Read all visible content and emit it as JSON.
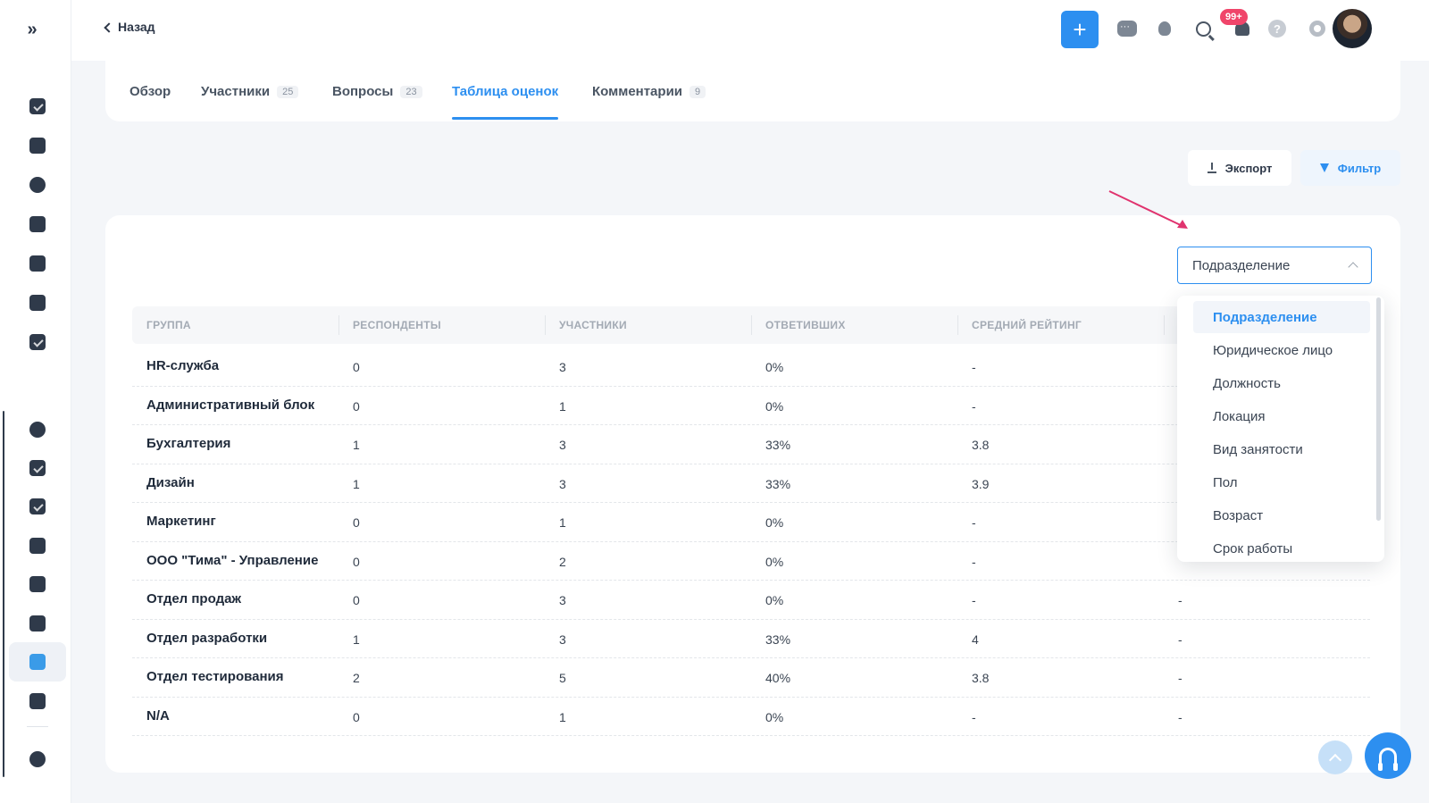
{
  "header": {
    "back_label": "Назад",
    "add_label": "+",
    "help_label": "?",
    "notifications_badge": "99+"
  },
  "tabs": [
    {
      "label": "Обзор",
      "count": ""
    },
    {
      "label": "Участники",
      "count": "25"
    },
    {
      "label": "Вопросы",
      "count": "23"
    },
    {
      "label": "Таблица оценок",
      "count": "",
      "active": true
    },
    {
      "label": "Комментарии",
      "count": "9"
    }
  ],
  "actions": {
    "export_label": "Экспорт",
    "filter_label": "Фильтр"
  },
  "grouping_select": {
    "value": "Подразделение",
    "options": [
      "Подразделение",
      "Юридическое лицо",
      "Должность",
      "Локация",
      "Вид занятости",
      "Пол",
      "Возраст",
      "Срок работы"
    ]
  },
  "table": {
    "columns": [
      "ГРУППА",
      "РЕСПОНДЕНТЫ",
      "УЧАСТНИКИ",
      "ОТВЕТИВШИХ",
      "СРЕДНИЙ РЕЙТИНГ"
    ],
    "rows": [
      {
        "group": "HR-служба",
        "respondents": "0",
        "participants": "3",
        "answered": "0%",
        "rating": "-",
        "extra": ""
      },
      {
        "group": "Административный блок",
        "respondents": "0",
        "participants": "1",
        "answered": "0%",
        "rating": "-",
        "extra": ""
      },
      {
        "group": "Бухгалтерия",
        "respondents": "1",
        "participants": "3",
        "answered": "33%",
        "rating": "3.8",
        "extra": ""
      },
      {
        "group": "Дизайн",
        "respondents": "1",
        "participants": "3",
        "answered": "33%",
        "rating": "3.9",
        "extra": ""
      },
      {
        "group": "Маркетинг",
        "respondents": "0",
        "participants": "1",
        "answered": "0%",
        "rating": "-",
        "extra": ""
      },
      {
        "group": "ООО \"Тима\" - Управление",
        "respondents": "0",
        "participants": "2",
        "answered": "0%",
        "rating": "-",
        "extra": ""
      },
      {
        "group": "Отдел продаж",
        "respondents": "0",
        "participants": "3",
        "answered": "0%",
        "rating": "-",
        "extra": "-"
      },
      {
        "group": "Отдел разработки",
        "respondents": "1",
        "participants": "3",
        "answered": "33%",
        "rating": "4",
        "extra": "-"
      },
      {
        "group": "Отдел тестирования",
        "respondents": "2",
        "participants": "5",
        "answered": "40%",
        "rating": "3.8",
        "extra": "-"
      },
      {
        "group": "N/A",
        "respondents": "0",
        "participants": "1",
        "answered": "0%",
        "rating": "-",
        "extra": "-"
      }
    ]
  },
  "colors": {
    "accent": "#2d8ff0",
    "badge": "#f0456a",
    "arrow": "#e0336e"
  }
}
